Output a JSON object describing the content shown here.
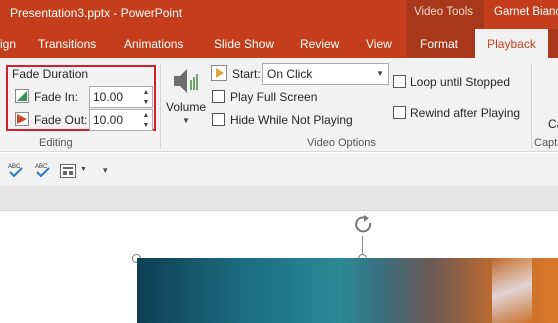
{
  "titlebar": {
    "document_title": "Presentation3.pptx  -  PowerPoint",
    "context_group": "Video Tools",
    "user_name": "Garnet Bianc"
  },
  "tabs": [
    {
      "label": "ign",
      "active": false
    },
    {
      "label": "Transitions",
      "active": false
    },
    {
      "label": "Animations",
      "active": false
    },
    {
      "label": "Slide Show",
      "active": false
    },
    {
      "label": "Review",
      "active": false
    },
    {
      "label": "View",
      "active": false
    },
    {
      "label": "Format",
      "active": false
    },
    {
      "label": "Playback",
      "active": true
    }
  ],
  "ribbon": {
    "editing": {
      "group_label": "Editing",
      "fade_duration_label": "Fade Duration",
      "fade_in_label": "Fade In:",
      "fade_in_value": "10.00",
      "fade_out_label": "Fade Out:",
      "fade_out_value": "10.00"
    },
    "video_options": {
      "group_label": "Video Options",
      "volume_label": "Volume",
      "start_label": "Start:",
      "start_value": "On Click",
      "play_full_screen_label": "Play Full Screen",
      "hide_while_not_playing_label": "Hide While Not Playing",
      "loop_until_stopped_label": "Loop until Stopped",
      "rewind_after_playing_label": "Rewind after Playing"
    },
    "captions": {
      "group_label": "Capt",
      "button_label": "Ca"
    }
  },
  "colors": {
    "accent": "#c43e1c",
    "context_dark": "#a9371a",
    "highlight_box": "#d0202a"
  },
  "icons": {
    "volume": "speaker-icon",
    "start": "play-start-icon",
    "qat": [
      "spelling-check-icon",
      "spelling-check-icon",
      "layout-icon",
      "customize-qat-icon"
    ]
  }
}
